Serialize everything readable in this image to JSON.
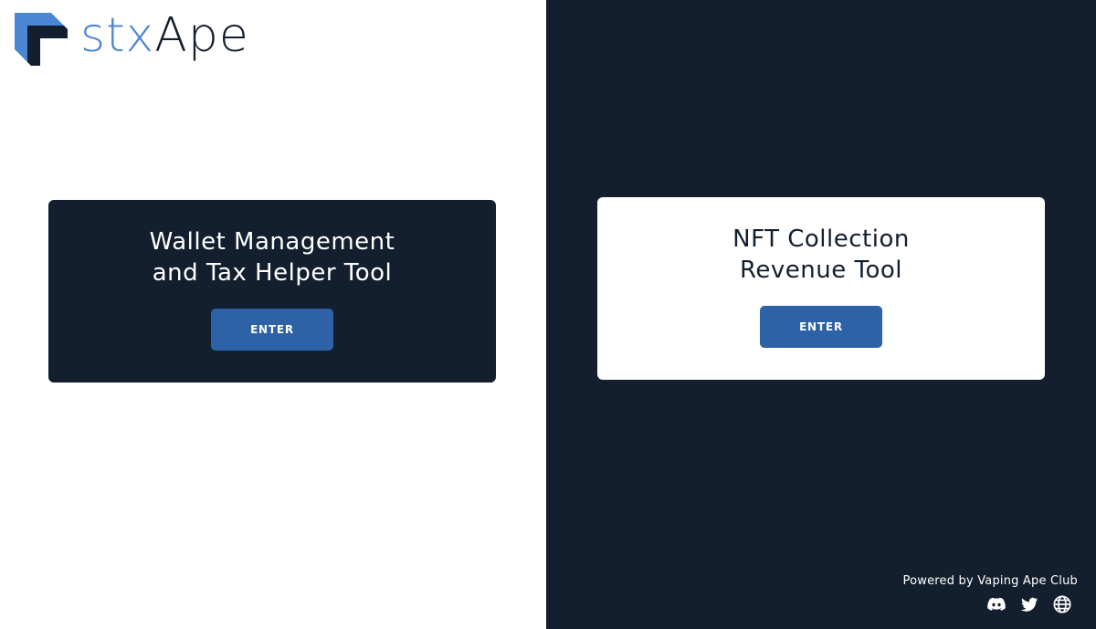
{
  "brand": {
    "logo_text_part_a": "stx",
    "logo_text_part_b": "Ape",
    "logo_icon": "stxape-logo-mark",
    "accent_color": "#4a86d4",
    "dark_color": "#131f2e"
  },
  "cards": [
    {
      "title_line_1": "Wallet Management",
      "title_line_2": "and Tax Helper Tool",
      "button_label": "ENTER",
      "theme": "dark"
    },
    {
      "title_line_1": "NFT Collection",
      "title_line_2": "Revenue Tool",
      "button_label": "ENTER",
      "theme": "light"
    }
  ],
  "footer": {
    "powered_by": "Powered by Vaping Ape Club",
    "social_icons": [
      "discord-icon",
      "twitter-icon",
      "globe-icon"
    ]
  },
  "colors": {
    "button_blue": "#2d62a6",
    "right_pane_bg": "#131f2e",
    "left_pane_bg": "#ffffff"
  }
}
